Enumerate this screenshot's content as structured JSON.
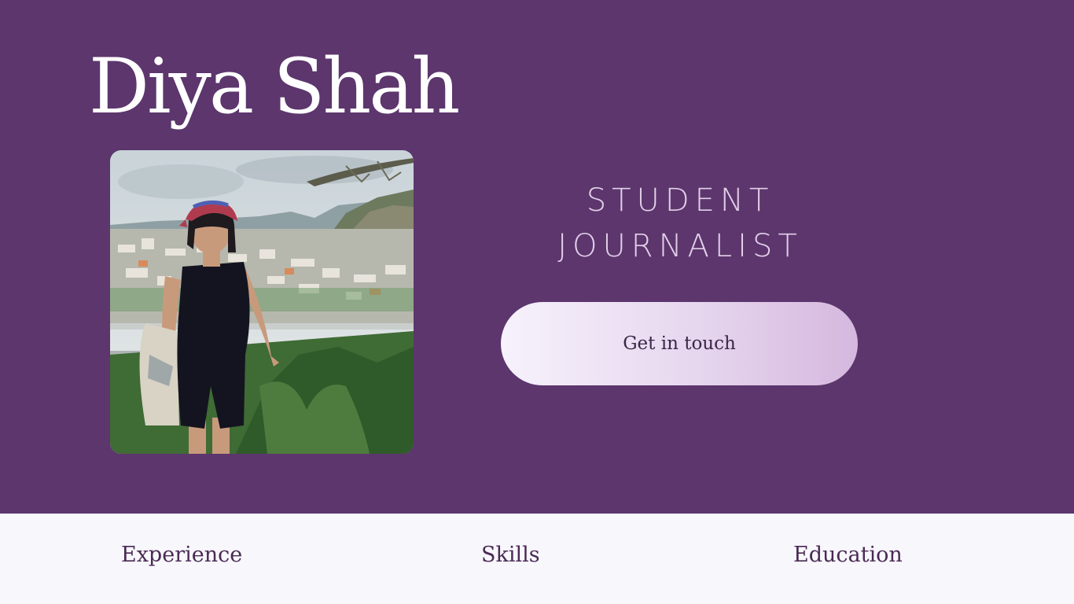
{
  "hero": {
    "name": "Diya Shah",
    "tagline_line1": "STUDENT",
    "tagline_line2": "JOURNALIST",
    "cta_label": "Get in touch",
    "background_color": "#5c366d"
  },
  "nav": {
    "items": [
      {
        "label": "Experience"
      },
      {
        "label": "Skills"
      },
      {
        "label": "Education"
      }
    ]
  }
}
